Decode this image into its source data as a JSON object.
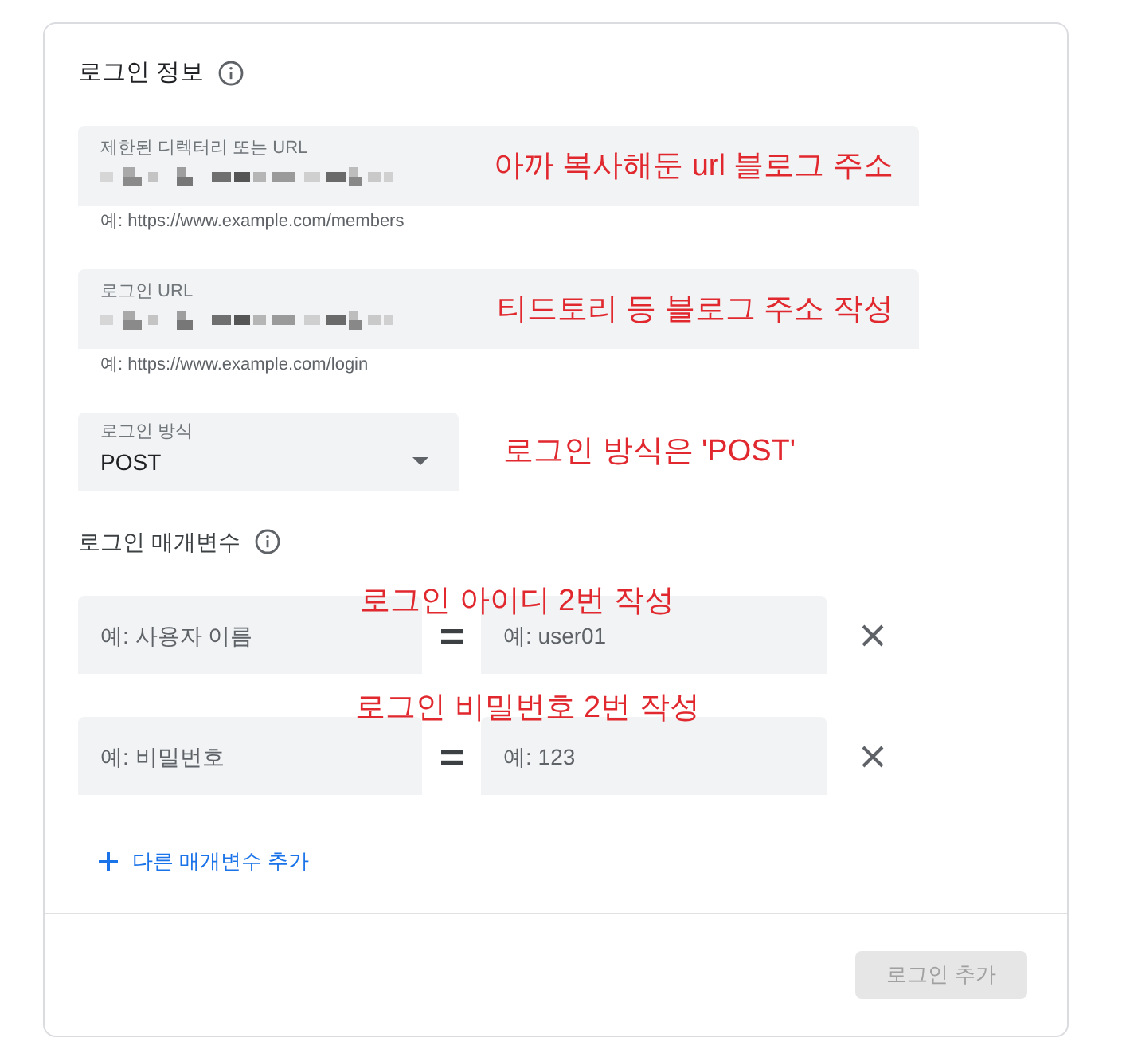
{
  "login_info": {
    "title": "로그인 정보",
    "fields": [
      {
        "kind": "text",
        "label": "제한된 디렉터리 또는 URL",
        "redacted": true,
        "helper": "예: https://www.example.com/members",
        "annotation": "아까 복사해둔 url 블로그 주소"
      },
      {
        "kind": "text",
        "label": "로그인 URL",
        "redacted": true,
        "helper": "예: https://www.example.com/login",
        "annotation": "티드토리 등 블로그 주소 작성"
      },
      {
        "kind": "select",
        "label": "로그인 방식",
        "value": "POST",
        "annotation": "로그인 방식은 'POST'"
      }
    ]
  },
  "login_parameters": {
    "title": "로그인 매개변수",
    "rows": [
      {
        "name_placeholder": "예: 사용자 이름",
        "value_placeholder": "예: user01",
        "annotation": "로그인 아이디 2번 작성"
      },
      {
        "name_placeholder": "예: 비밀번호",
        "value_placeholder": "예: 123",
        "annotation": "로그인 비밀번호 2번 작성"
      }
    ],
    "add_link": "다른 매개변수 추가"
  },
  "footer": {
    "button": {
      "label": "로그인 추가",
      "disabled": true
    }
  }
}
